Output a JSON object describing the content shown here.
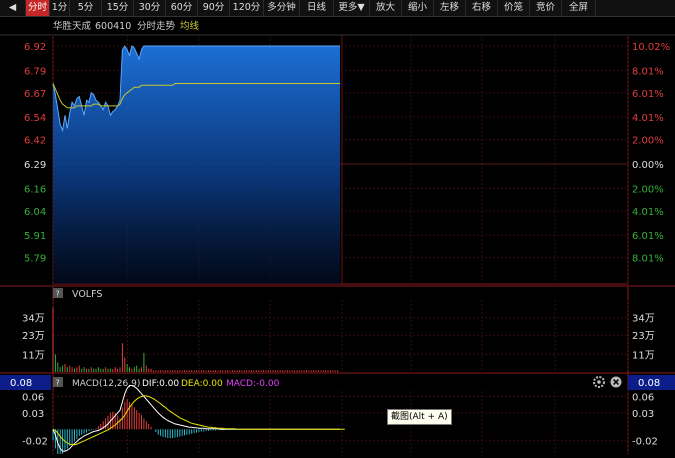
{
  "toolbar": {
    "items": [
      {
        "label": "◀",
        "name": "prev-arrow-button"
      },
      {
        "label": "分时",
        "name": "tab-intraday",
        "active": true
      },
      {
        "label": "1分",
        "name": "tab-1min"
      },
      {
        "label": "5分",
        "name": "tab-5min"
      },
      {
        "label": "15分",
        "name": "tab-15min"
      },
      {
        "label": "30分",
        "name": "tab-30min"
      },
      {
        "label": "60分",
        "name": "tab-60min"
      },
      {
        "label": "90分",
        "name": "tab-90min"
      },
      {
        "label": "120分",
        "name": "tab-120min"
      },
      {
        "label": "多分钟",
        "name": "tab-multi-min"
      },
      {
        "label": "日线",
        "name": "tab-daily"
      },
      {
        "label": "更多▼",
        "name": "more-menu-button"
      },
      {
        "label": "放大",
        "name": "zoom-in-button"
      },
      {
        "label": "缩小",
        "name": "zoom-out-button"
      },
      {
        "label": "左移",
        "name": "move-left-button"
      },
      {
        "label": "右移",
        "name": "move-right-button"
      },
      {
        "label": "价笼",
        "name": "price-cage-button"
      },
      {
        "label": "竞价",
        "name": "auction-button"
      },
      {
        "label": "全屏",
        "name": "fullscreen-button"
      }
    ]
  },
  "stock": {
    "name": "华胜天成",
    "code": "600410",
    "chart_label": "分时走势",
    "avg_label": "均线"
  },
  "price_axis": {
    "left": [
      "6.92",
      "6.79",
      "6.67",
      "6.54",
      "6.42",
      "6.29",
      "6.16",
      "6.04",
      "5.91",
      "5.79"
    ],
    "right": [
      "10.02%",
      "8.01%",
      "6.01%",
      "4.01%",
      "2.00%",
      "0.00%",
      "2.00%",
      "4.01%",
      "6.01%",
      "8.01%"
    ]
  },
  "volume": {
    "label": "VOLFS",
    "ticks": [
      "34万",
      "23万",
      "11万"
    ]
  },
  "macd": {
    "current_value": "0.08",
    "title": "MACD(12,26,9)",
    "dif": "DIF:0.00",
    "dea": "DEA:0.00",
    "macd": "MACD:-0.00",
    "ticks": [
      "0.06",
      "0.03",
      "-0.02"
    ]
  },
  "tooltip": "截图(Alt + A)",
  "colors": {
    "up": "#e23c3c",
    "down": "#35b035",
    "price_line": "#1e90ff",
    "avg_line": "#c8c830",
    "accent": "#c62828",
    "badge": "#0c1d8a",
    "dif": "#ffffff",
    "dea": "#e6e600",
    "macd": "#e040fb"
  },
  "chart_data": {
    "type": "line",
    "prev_close": 6.29,
    "ylim": [
      5.66,
      6.92
    ],
    "x": [
      0,
      1,
      2,
      3,
      4,
      5,
      6,
      7,
      8,
      9,
      10,
      11,
      12,
      13,
      14,
      15,
      16,
      17,
      18,
      19,
      20,
      21,
      22,
      23,
      24,
      25,
      26,
      27,
      28,
      29,
      30,
      31,
      32,
      33,
      34,
      35,
      36,
      37,
      38,
      39,
      40,
      41,
      42,
      43,
      44,
      45,
      46,
      47,
      48,
      49,
      50,
      51,
      52,
      53,
      54,
      55,
      56,
      57,
      58,
      59,
      60,
      61,
      62,
      63,
      64,
      65,
      66,
      67,
      68,
      69,
      70,
      71,
      72,
      73,
      74,
      75,
      76,
      77,
      78,
      79,
      80,
      81,
      82,
      83,
      84,
      85,
      86,
      87,
      88,
      89,
      90,
      91,
      92,
      93,
      94,
      95,
      96,
      97,
      98,
      99,
      100,
      101,
      102,
      103,
      104,
      105,
      106,
      107,
      108,
      109,
      110,
      111,
      112,
      113,
      114,
      115,
      116,
      117,
      118,
      119,
      120
    ],
    "series": [
      {
        "name": "price",
        "values": [
          6.72,
          6.66,
          6.58,
          6.5,
          6.47,
          6.55,
          6.48,
          6.56,
          6.62,
          6.6,
          6.64,
          6.65,
          6.6,
          6.55,
          6.63,
          6.62,
          6.67,
          6.66,
          6.63,
          6.62,
          6.6,
          6.58,
          6.62,
          6.6,
          6.55,
          6.57,
          6.58,
          6.6,
          6.63,
          6.9,
          6.92,
          6.9,
          6.87,
          6.92,
          6.91,
          6.88,
          6.85,
          6.9,
          6.92,
          6.92,
          6.92,
          6.92,
          6.92,
          6.92,
          6.92,
          6.92,
          6.92,
          6.92,
          6.92,
          6.92,
          6.92,
          6.92,
          6.92,
          6.92,
          6.92,
          6.92,
          6.92,
          6.92,
          6.92,
          6.92,
          6.92,
          6.92,
          6.92,
          6.92,
          6.92,
          6.92,
          6.92,
          6.92,
          6.92,
          6.92,
          6.92,
          6.92,
          6.92,
          6.92,
          6.92,
          6.92,
          6.92,
          6.92,
          6.92,
          6.92,
          6.92,
          6.92,
          6.92,
          6.92,
          6.92,
          6.92,
          6.92,
          6.92,
          6.92,
          6.92,
          6.92,
          6.92,
          6.92,
          6.92,
          6.92,
          6.92,
          6.92,
          6.92,
          6.92,
          6.92,
          6.92,
          6.92,
          6.92,
          6.92,
          6.92,
          6.92,
          6.92,
          6.92,
          6.92,
          6.92,
          6.92,
          6.92,
          6.92,
          6.92,
          6.92,
          6.92,
          6.92,
          6.92,
          6.92,
          6.92,
          6.92
        ]
      },
      {
        "name": "avg",
        "values": [
          6.72,
          6.69,
          6.66,
          6.63,
          6.61,
          6.6,
          6.59,
          6.59,
          6.59,
          6.59,
          6.6,
          6.6,
          6.6,
          6.6,
          6.6,
          6.6,
          6.6,
          6.61,
          6.61,
          6.61,
          6.6,
          6.6,
          6.6,
          6.6,
          6.6,
          6.6,
          6.6,
          6.6,
          6.61,
          6.64,
          6.66,
          6.67,
          6.68,
          6.69,
          6.7,
          6.7,
          6.7,
          6.71,
          6.71,
          6.71,
          6.71,
          6.71,
          6.71,
          6.71,
          6.71,
          6.71,
          6.71,
          6.71,
          6.71,
          6.71,
          6.71,
          6.72,
          6.72,
          6.72,
          6.72,
          6.72,
          6.72,
          6.72,
          6.72,
          6.72,
          6.72,
          6.72,
          6.72,
          6.72,
          6.72,
          6.72,
          6.72,
          6.72,
          6.72,
          6.72,
          6.72,
          6.72,
          6.72,
          6.72,
          6.72,
          6.72,
          6.72,
          6.72,
          6.72,
          6.72,
          6.72,
          6.72,
          6.72,
          6.72,
          6.72,
          6.72,
          6.72,
          6.72,
          6.72,
          6.72,
          6.72,
          6.72,
          6.72,
          6.72,
          6.72,
          6.72,
          6.72,
          6.72,
          6.72,
          6.72,
          6.72,
          6.72,
          6.72,
          6.72,
          6.72,
          6.72,
          6.72,
          6.72,
          6.72,
          6.72,
          6.72,
          6.72,
          6.72,
          6.72,
          6.72,
          6.72,
          6.72,
          6.72,
          6.72,
          6.72,
          6.72
        ]
      }
    ],
    "volume": [
      40,
      11,
      6,
      3,
      4,
      5,
      3,
      4,
      3,
      2,
      3,
      4,
      2,
      3,
      2,
      2,
      3,
      2,
      2,
      3,
      2,
      2,
      3,
      2,
      2,
      2,
      3,
      2,
      3,
      18,
      9,
      5,
      3,
      2,
      3,
      4,
      2,
      3,
      12,
      4,
      2,
      2,
      1,
      1,
      1,
      1,
      1,
      1,
      1,
      1,
      1,
      1,
      1,
      1,
      1,
      1,
      1,
      1,
      1,
      1,
      1,
      1,
      1,
      1,
      1,
      1,
      1,
      1,
      1,
      1,
      1,
      1,
      1,
      1,
      1,
      1,
      1,
      1,
      1,
      1,
      1,
      1,
      1,
      1,
      1,
      1,
      1,
      1,
      1,
      1,
      1,
      1,
      1,
      1,
      1,
      1,
      1,
      1,
      1,
      1,
      1,
      1,
      1,
      1,
      1,
      1,
      1,
      1,
      1,
      1,
      1,
      1,
      1,
      1,
      1,
      1,
      1,
      1,
      1,
      1
    ],
    "volume_dir": [
      1,
      -1,
      -1,
      -1,
      -1,
      1,
      -1,
      1,
      1,
      -1,
      1,
      1,
      -1,
      -1,
      1,
      -1,
      1,
      -1,
      -1,
      -1,
      -1,
      -1,
      1,
      -1,
      -1,
      1,
      1,
      1,
      1,
      1,
      1,
      -1,
      -1,
      1,
      -1,
      -1,
      -1,
      1,
      -1,
      1,
      1,
      1,
      1,
      1,
      1,
      1,
      1,
      1,
      1,
      1,
      1,
      1,
      1,
      1,
      1,
      1,
      1,
      1,
      1,
      1,
      1,
      1,
      1,
      1,
      1,
      1,
      1,
      1,
      1,
      1,
      1,
      1,
      1,
      1,
      1,
      1,
      1,
      1,
      1,
      1,
      1,
      1,
      1,
      1,
      1,
      1,
      1,
      1,
      1,
      1,
      1,
      1,
      1,
      1,
      1,
      1,
      1,
      1,
      1,
      1,
      1,
      1,
      1,
      1,
      1,
      1,
      1,
      1,
      1,
      1,
      1,
      1,
      1,
      1,
      1,
      1,
      1,
      1,
      1,
      1
    ],
    "volume_ylim": [
      0,
      45
    ],
    "macd_hist": [
      -0.02,
      -0.035,
      -0.045,
      -0.05,
      -0.045,
      -0.04,
      -0.035,
      -0.03,
      -0.028,
      -0.022,
      -0.018,
      -0.012,
      -0.01,
      -0.008,
      -0.006,
      -0.003,
      -0.002,
      -0.001,
      0.002,
      0.006,
      0.01,
      0.015,
      0.02,
      0.025,
      0.03,
      0.032,
      0.03,
      0.025,
      0.02,
      0.04,
      0.05,
      0.055,
      0.05,
      0.045,
      0.04,
      0.035,
      0.03,
      0.026,
      0.02,
      0.015,
      0.01,
      0.005,
      0.0,
      -0.005,
      -0.01,
      -0.012,
      -0.014,
      -0.015,
      -0.016,
      -0.016,
      -0.016,
      -0.015,
      -0.014,
      -0.013,
      -0.012,
      -0.011,
      -0.01,
      -0.009,
      -0.008,
      -0.007,
      -0.006,
      -0.005,
      -0.004,
      -0.004,
      -0.003,
      -0.003,
      -0.002,
      -0.002,
      -0.002,
      -0.001,
      -0.001,
      -0.001,
      -0.001,
      -0.001,
      -0.001,
      0,
      0,
      0,
      0,
      0,
      0,
      0,
      0,
      0,
      0,
      0,
      0,
      0,
      0,
      0,
      0,
      0,
      0,
      0,
      0,
      0,
      0,
      0,
      0,
      0,
      0,
      0,
      0,
      0,
      0,
      0,
      0,
      0,
      0,
      0,
      0,
      0,
      0,
      0,
      0,
      0,
      0,
      0,
      0,
      0,
      0
    ],
    "macd_dif": [
      0,
      -0.01,
      -0.025,
      -0.035,
      -0.04,
      -0.04,
      -0.038,
      -0.035,
      -0.03,
      -0.026,
      -0.022,
      -0.018,
      -0.015,
      -0.012,
      -0.01,
      -0.008,
      -0.006,
      -0.004,
      -0.003,
      -0.002,
      0.0,
      0.003,
      0.006,
      0.01,
      0.015,
      0.02,
      0.025,
      0.03,
      0.035,
      0.05,
      0.065,
      0.075,
      0.08,
      0.08,
      0.078,
      0.075,
      0.07,
      0.065,
      0.06,
      0.055,
      0.05,
      0.045,
      0.04,
      0.035,
      0.03,
      0.026,
      0.022,
      0.019,
      0.016,
      0.014,
      0.012,
      0.01,
      0.009,
      0.008,
      0.007,
      0.006,
      0.005,
      0.004,
      0.004,
      0.003,
      0.003,
      0.002,
      0.002,
      0.002,
      0.001,
      0.001,
      0.001,
      0.001,
      0.001,
      0.001,
      0.0,
      0,
      0,
      0,
      0,
      0,
      0,
      0,
      0,
      0,
      0,
      0,
      0,
      0,
      0,
      0,
      0,
      0,
      0,
      0,
      0,
      0,
      0,
      0,
      0,
      0,
      0,
      0,
      0,
      0,
      0,
      0,
      0,
      0,
      0,
      0,
      0,
      0,
      0,
      0,
      0,
      0,
      0,
      0,
      0,
      0,
      0,
      0,
      0,
      0,
      0
    ],
    "macd_dea": [
      0,
      -0.002,
      -0.007,
      -0.013,
      -0.018,
      -0.022,
      -0.025,
      -0.027,
      -0.028,
      -0.028,
      -0.027,
      -0.025,
      -0.023,
      -0.021,
      -0.019,
      -0.017,
      -0.015,
      -0.013,
      -0.011,
      -0.009,
      -0.007,
      -0.005,
      -0.003,
      -0.001,
      0.002,
      0.005,
      0.008,
      0.012,
      0.016,
      0.02,
      0.026,
      0.033,
      0.04,
      0.046,
      0.051,
      0.055,
      0.058,
      0.06,
      0.061,
      0.061,
      0.06,
      0.058,
      0.056,
      0.053,
      0.05,
      0.047,
      0.043,
      0.04,
      0.036,
      0.033,
      0.03,
      0.027,
      0.024,
      0.021,
      0.019,
      0.017,
      0.015,
      0.013,
      0.011,
      0.01,
      0.009,
      0.008,
      0.007,
      0.006,
      0.005,
      0.004,
      0.004,
      0.003,
      0.003,
      0.002,
      0.002,
      0.002,
      0.001,
      0.001,
      0.001,
      0.001,
      0.001,
      0,
      0,
      0,
      0,
      0,
      0,
      0,
      0,
      0,
      0,
      0,
      0,
      0,
      0,
      0,
      0,
      0,
      0,
      0,
      0,
      0,
      0,
      0,
      0,
      0,
      0,
      0,
      0,
      0,
      0,
      0,
      0,
      0,
      0,
      0,
      0,
      0,
      0,
      0,
      0,
      0,
      0,
      0,
      0,
      0,
      0
    ],
    "macd_ylim": [
      -0.045,
      0.07
    ]
  }
}
